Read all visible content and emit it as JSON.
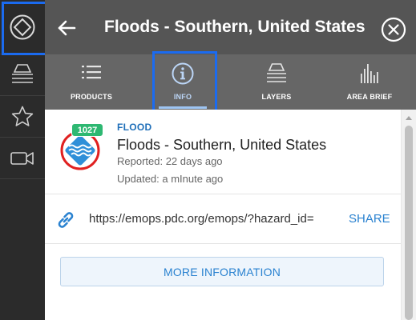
{
  "rail": {
    "items": [
      {
        "icon": "hazard-diamond-icon",
        "active": true
      },
      {
        "icon": "layers-stack-icon",
        "active": false
      },
      {
        "icon": "star-icon",
        "active": false
      },
      {
        "icon": "video-camera-icon",
        "active": false
      }
    ]
  },
  "header": {
    "back_icon": "arrow-left-icon",
    "title": "Floods - Southern, United States",
    "close_icon": "close-circle-icon"
  },
  "tabs": [
    {
      "label": "PRODUCTS",
      "icon": "list-icon",
      "active": false
    },
    {
      "label": "INFO",
      "icon": "info-circle-icon",
      "active": true
    },
    {
      "label": "LAYERS",
      "icon": "layers-icon",
      "active": false
    },
    {
      "label": "AREA BRIEF",
      "icon": "bar-chart-icon",
      "active": false
    }
  ],
  "hazard": {
    "count": "1027",
    "type": "FLOOD",
    "name": "Floods - Southern, United States",
    "reported": "Reported: 22 days ago",
    "updated": "Updated: a mInute ago",
    "icon": "flood-hazard-icon"
  },
  "link": {
    "icon": "link-icon",
    "url": "https://emops.pdc.org/emops/?hazard_id=",
    "share_label": "SHARE"
  },
  "more_info_label": "MORE INFORMATION",
  "colors": {
    "rail_bg": "#2b2b2b",
    "header_bg": "#555555",
    "tabs_bg": "#666666",
    "accent": "#2a82d0",
    "highlight": "#1b6bf0",
    "badge_green": "#2eb872",
    "hazard_red": "#e02020"
  }
}
